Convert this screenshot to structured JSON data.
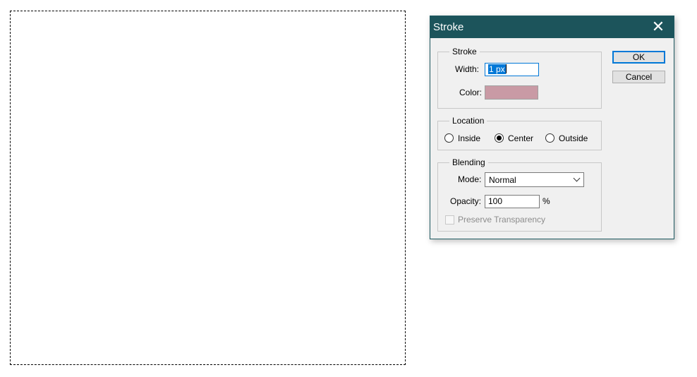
{
  "dialog": {
    "title": "Stroke",
    "close_glyph": "✕",
    "close_icon": "close-icon"
  },
  "stroke": {
    "legend": "Stroke",
    "width_label": "Width:",
    "width_value": "1 px",
    "color_label": "Color:",
    "color_value": "#c99aa5"
  },
  "location": {
    "legend": "Location",
    "options": [
      {
        "label": "Inside",
        "checked": false
      },
      {
        "label": "Center",
        "checked": true
      },
      {
        "label": "Outside",
        "checked": false
      }
    ]
  },
  "blending": {
    "legend": "Blending",
    "mode_label": "Mode:",
    "mode_value": "Normal",
    "opacity_label": "Opacity:",
    "opacity_value": "100",
    "opacity_unit": "%",
    "preserve_label": "Preserve Transparency",
    "preserve_checked": false,
    "preserve_enabled": false
  },
  "buttons": {
    "ok": "OK",
    "cancel": "Cancel"
  },
  "colors": {
    "titlebar": "#1c545b",
    "accent": "#0078d7"
  }
}
